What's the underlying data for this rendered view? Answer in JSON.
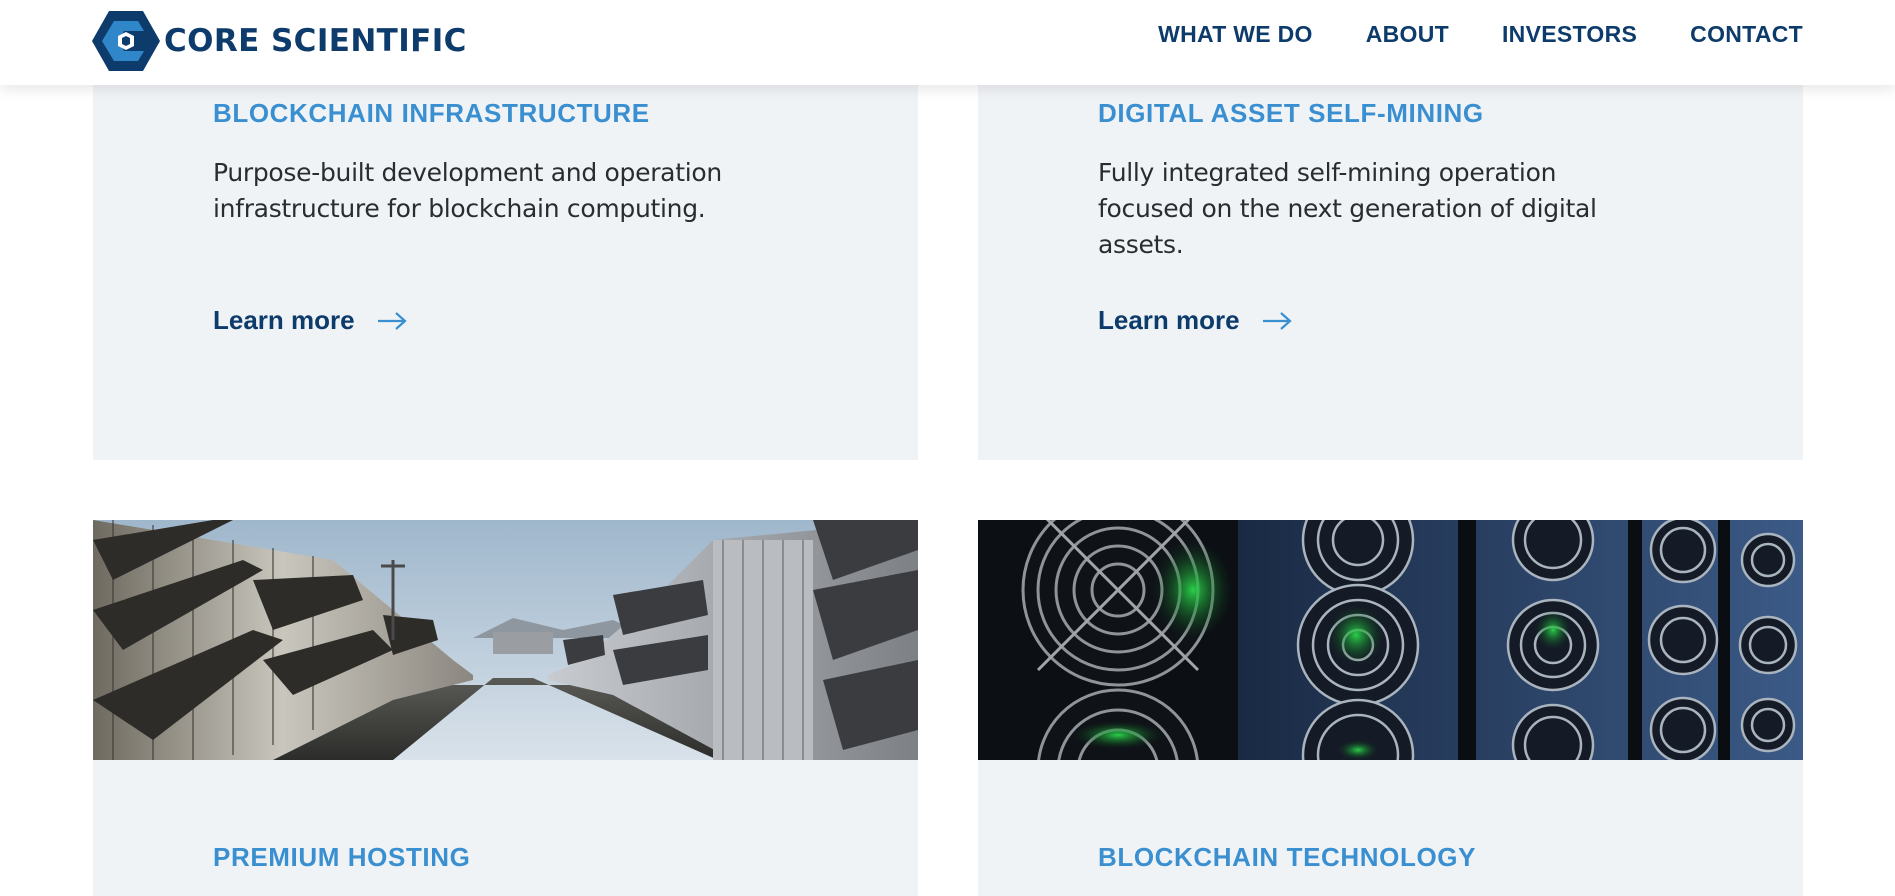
{
  "header": {
    "logo_text": "CORE SCIENTIFIC",
    "nav": [
      "WHAT WE DO",
      "ABOUT",
      "INVESTORS",
      "CONTACT"
    ]
  },
  "cards": [
    {
      "title": "BLOCKCHAIN INFRASTRUCTURE",
      "description": "Purpose-built development and operation infrastructure for blockchain computing.",
      "link": "Learn more"
    },
    {
      "title": "DIGITAL ASSET SELF-MINING",
      "description": "Fully integrated self-mining operation focused on the next generation of digital assets.",
      "link": "Learn more"
    },
    {
      "title": "PREMIUM HOSTING"
    },
    {
      "title": "BLOCKCHAIN TECHNOLOGY"
    }
  ],
  "colors": {
    "brand_navy": "#0d3b6b",
    "accent_blue": "#3a8fd1",
    "card_background": "#f0f3f6",
    "fan_glow": "#2bd84a"
  },
  "icons": [
    "core-scientific-logo-icon",
    "arrow-right-icon"
  ]
}
